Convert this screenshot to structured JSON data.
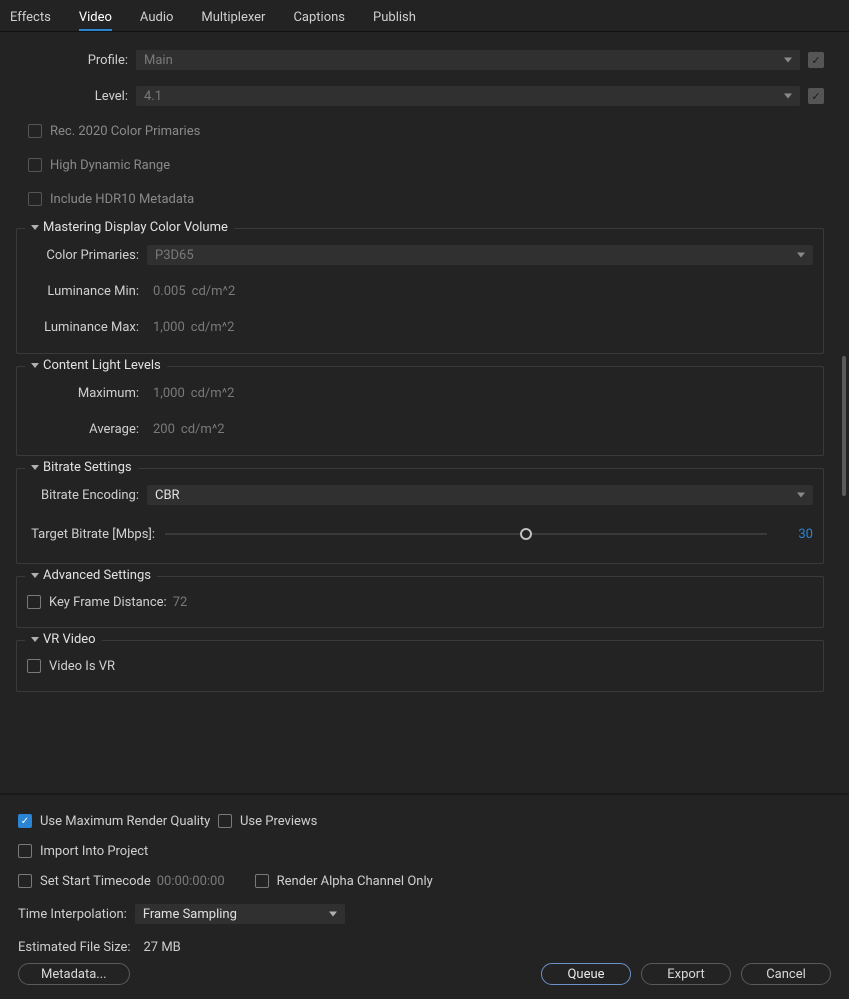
{
  "tabs": [
    "Effects",
    "Video",
    "Audio",
    "Multiplexer",
    "Captions",
    "Publish"
  ],
  "active_tab": "Video",
  "profile": {
    "label": "Profile:",
    "value": "Main"
  },
  "level": {
    "label": "Level:",
    "value": "4.1"
  },
  "checks": {
    "rec2020": "Rec. 2020 Color Primaries",
    "hdr": "High Dynamic Range",
    "hdr10": "Include HDR10 Metadata"
  },
  "mdcv": {
    "title": "Mastering Display Color Volume",
    "primaries_label": "Color Primaries:",
    "primaries_value": "P3D65",
    "lmin_label": "Luminance Min:",
    "lmin_value": "0.005",
    "lmax_label": "Luminance Max:",
    "lmax_value": "1,000",
    "unit": "cd/m^2"
  },
  "cll": {
    "title": "Content Light Levels",
    "max_label": "Maximum:",
    "max_value": "1,000",
    "avg_label": "Average:",
    "avg_value": "200",
    "unit": "cd/m^2"
  },
  "bitrate": {
    "title": "Bitrate Settings",
    "encoding_label": "Bitrate Encoding:",
    "encoding_value": "CBR",
    "target_label": "Target Bitrate [Mbps]:",
    "target_value": "30"
  },
  "advanced": {
    "title": "Advanced Settings",
    "kfd_label": "Key Frame Distance:",
    "kfd_value": "72"
  },
  "vr": {
    "title": "VR Video",
    "isvr": "Video Is VR"
  },
  "footer": {
    "max_quality": "Use Maximum Render Quality",
    "use_previews": "Use Previews",
    "import_project": "Import Into Project",
    "set_timecode": "Set Start Timecode",
    "timecode": "00:00:00:00",
    "render_alpha": "Render Alpha Channel Only",
    "interp_label": "Time Interpolation:",
    "interp_value": "Frame Sampling",
    "est_label": "Estimated File Size:",
    "est_value": "27 MB"
  },
  "buttons": {
    "metadata": "Metadata...",
    "queue": "Queue",
    "export": "Export",
    "cancel": "Cancel"
  }
}
